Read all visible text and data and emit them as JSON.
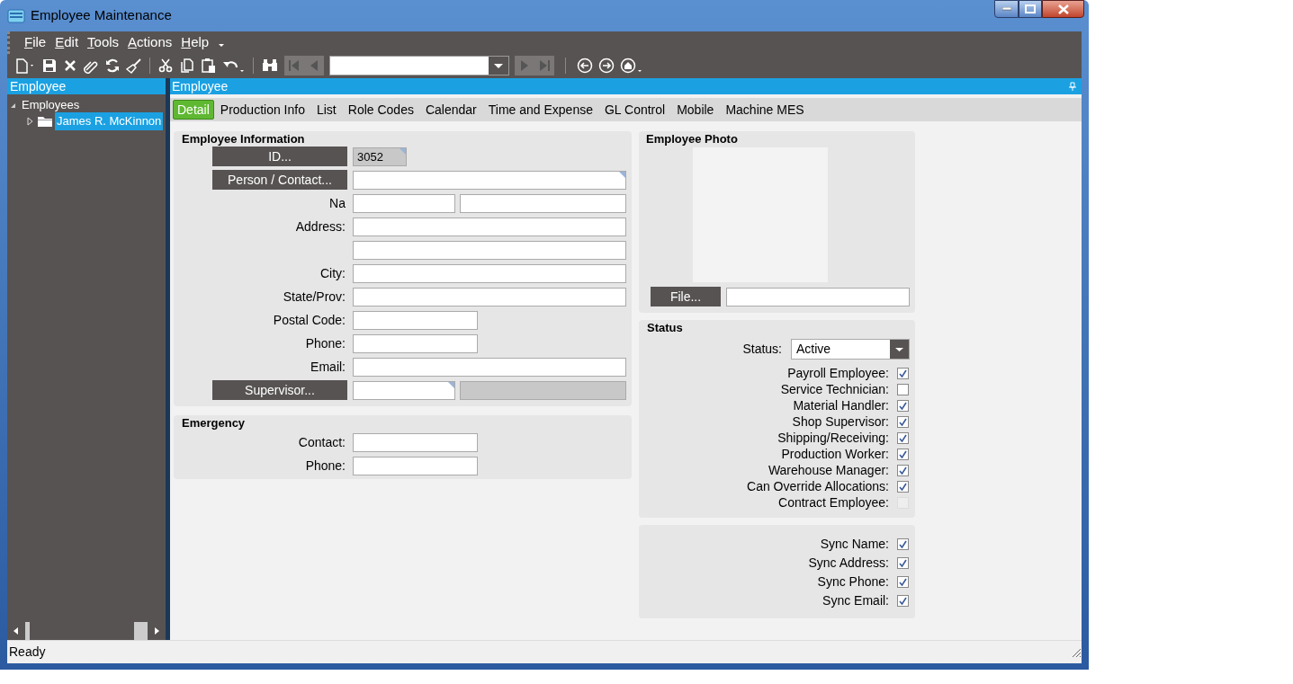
{
  "window": {
    "title": "Employee Maintenance"
  },
  "menu": [
    {
      "label": "File"
    },
    {
      "label": "Edit"
    },
    {
      "label": "Tools"
    },
    {
      "label": "Actions"
    },
    {
      "label": "Help"
    }
  ],
  "tree_panel": {
    "title": "Employee",
    "items": [
      {
        "label": "Employees",
        "expanded": true,
        "selected": false,
        "children": [
          {
            "label": "James R. McKinnon",
            "expanded": false,
            "selected": true
          }
        ]
      }
    ]
  },
  "main_panel": {
    "title": "Employee"
  },
  "tabs": [
    {
      "label": "Detail",
      "selected": true
    },
    {
      "label": "Production Info",
      "selected": false
    },
    {
      "label": "List",
      "selected": false
    },
    {
      "label": "Role Codes",
      "selected": false
    },
    {
      "label": "Calendar",
      "selected": false
    },
    {
      "label": "Time and Expense",
      "selected": false
    },
    {
      "label": "GL Control",
      "selected": false
    },
    {
      "label": "Mobile",
      "selected": false
    },
    {
      "label": "Machine MES",
      "selected": false
    }
  ],
  "employee_information": {
    "title": "Employee Information",
    "rows": [
      {
        "kind": "id",
        "label": "ID...",
        "value": "3052"
      },
      {
        "kind": "lookup",
        "label": "Person / Contact..."
      },
      {
        "kind": "name",
        "label": "Na"
      },
      {
        "kind": "field",
        "label": "Address:"
      },
      {
        "kind": "field"
      },
      {
        "kind": "field",
        "label": "City:"
      },
      {
        "kind": "field",
        "label": "State/Prov:"
      },
      {
        "kind": "short",
        "label": "Postal Code:"
      },
      {
        "kind": "short",
        "label": "Phone:"
      },
      {
        "kind": "field",
        "label": "Email:"
      },
      {
        "kind": "supervisor",
        "label": "Supervisor..."
      }
    ]
  },
  "emergency": {
    "title": "Emergency",
    "rows": [
      {
        "kind": "short",
        "label": "Contact:"
      },
      {
        "kind": "short",
        "label": "Phone:"
      }
    ]
  },
  "employee_photo": {
    "title": "Employee Photo",
    "file_button": "File..."
  },
  "status": {
    "title": "Status",
    "label": "Status:",
    "value": "Active",
    "flags": [
      {
        "label": "Payroll Employee:",
        "checked": true,
        "disabled": false
      },
      {
        "label": "Service Technician:",
        "checked": false,
        "disabled": false
      },
      {
        "label": "Material Handler:",
        "checked": true,
        "disabled": false
      },
      {
        "label": "Shop Supervisor:",
        "checked": true,
        "disabled": false
      },
      {
        "label": "Shipping/Receiving:",
        "checked": true,
        "disabled": false
      },
      {
        "label": "Production Worker:",
        "checked": true,
        "disabled": false
      },
      {
        "label": "Warehouse Manager:",
        "checked": true,
        "disabled": false
      },
      {
        "label": "Can Override Allocations:",
        "checked": true,
        "disabled": false
      },
      {
        "label": "Contract Employee:",
        "checked": false,
        "disabled": true
      }
    ]
  },
  "sync": [
    {
      "label": "Sync Name:",
      "checked": true
    },
    {
      "label": "Sync Address:",
      "checked": true
    },
    {
      "label": "Sync Phone:",
      "checked": true
    },
    {
      "label": "Sync Email:",
      "checked": true
    }
  ],
  "status_bar": {
    "text": "Ready"
  }
}
